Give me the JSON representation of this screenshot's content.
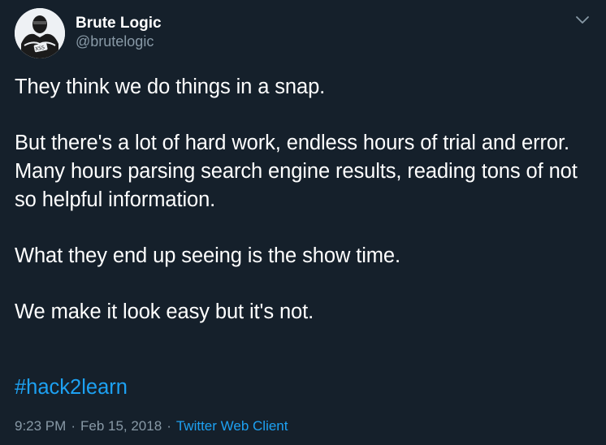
{
  "author": {
    "display_name": "Brute Logic",
    "handle": "@brutelogic",
    "avatar_text": "XSS"
  },
  "tweet": {
    "paragraphs": [
      "They think we do things in a snap.",
      "But there's a lot of hard work, endless hours of trial and error. Many hours parsing search engine results, reading tons of not so helpful information.",
      "What they end up seeing is the show time.",
      "We make it look easy but it's not."
    ],
    "hashtag": "#hack2learn"
  },
  "meta": {
    "time": "9:23 PM",
    "separator": "·",
    "date": "Feb 15, 2018",
    "client": "Twitter Web Client"
  },
  "colors": {
    "background": "#15202b",
    "text": "#ffffff",
    "secondary": "#8899a6",
    "accent": "#1da1f2"
  },
  "icons": {
    "more_menu": "chevron-down-icon"
  }
}
